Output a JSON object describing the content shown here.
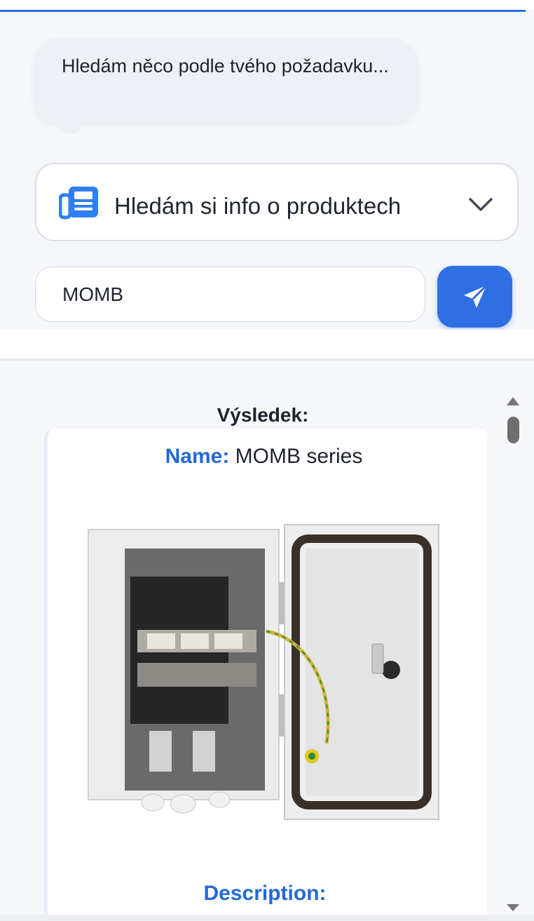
{
  "chat": {
    "assistant_message": "Hledám něco podle tvého požadavku..."
  },
  "mode_select": {
    "label": "Hledám si info o produktech",
    "icon": "newspaper-icon",
    "accent": "#2f7ff0"
  },
  "search": {
    "value": "MOMB",
    "send_icon": "paper-plane-icon",
    "send_color": "#2f6fe4"
  },
  "result": {
    "title": "Výsledek:",
    "name_key": "Name:",
    "name_value": "MOMB series",
    "description_label": "Description:"
  },
  "colors": {
    "accent_blue": "#2468d8",
    "background": "#f5f7fb"
  }
}
